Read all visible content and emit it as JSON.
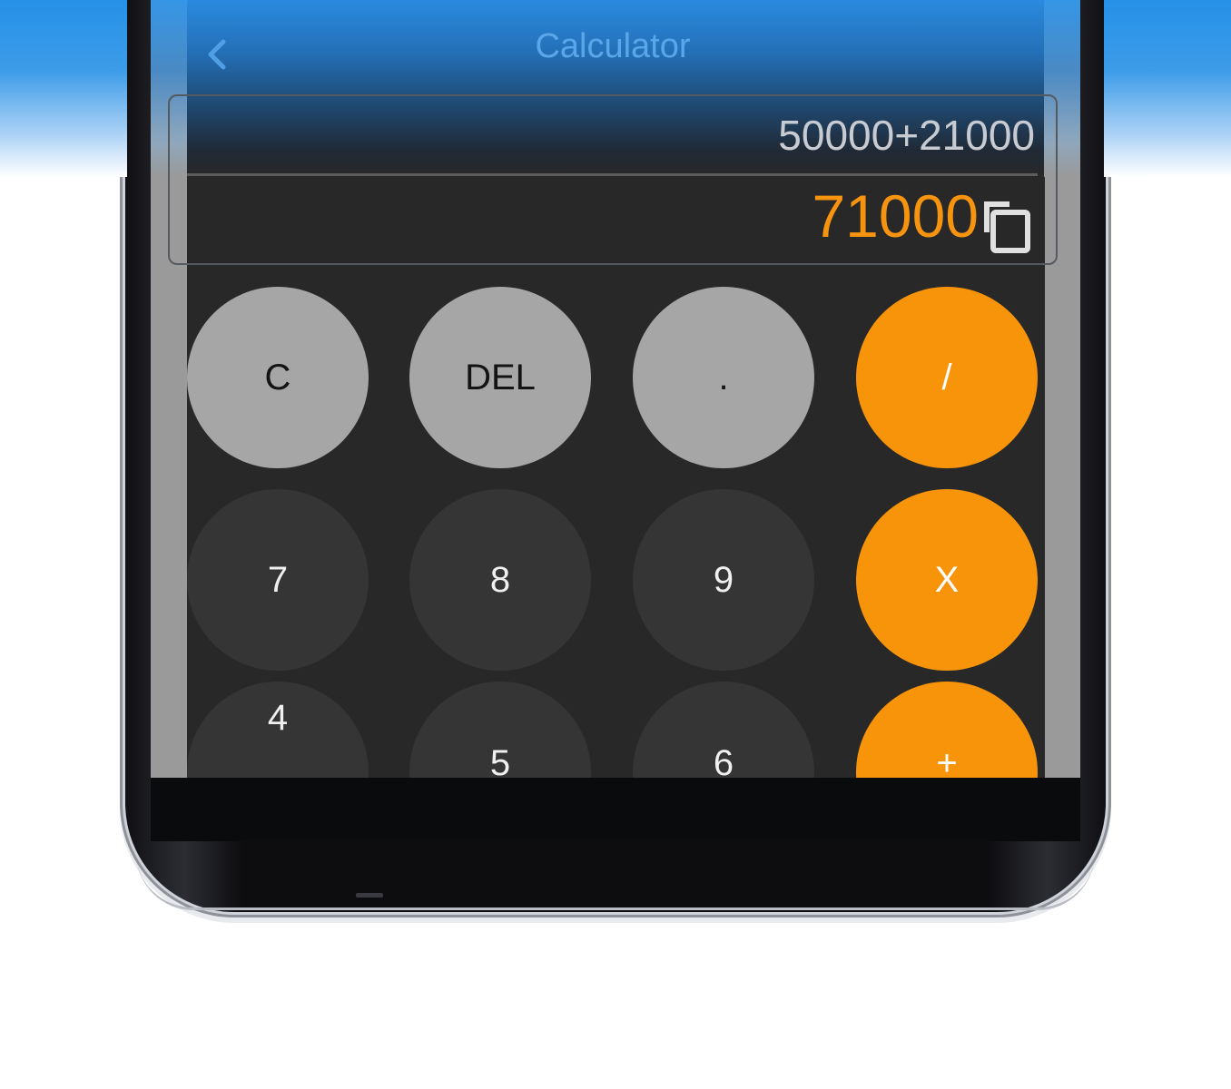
{
  "app": {
    "title": "Calculator"
  },
  "display": {
    "expression": "50000+21000",
    "result": "71000"
  },
  "icons": {
    "back": "chevron-left-icon",
    "copy": "copy-icon"
  },
  "colors": {
    "accent": "#f7940a",
    "operator_key": "#f7940a",
    "function_key": "#a6a6a6",
    "digit_key": "#353535",
    "background": "#282828",
    "header_blue": "#2490e6"
  },
  "keypad": {
    "row1": [
      "C",
      "DEL",
      ".",
      "/"
    ],
    "row2": [
      "7",
      "8",
      "9",
      "X"
    ],
    "row3": [
      "4",
      "5",
      "6",
      "+"
    ]
  }
}
